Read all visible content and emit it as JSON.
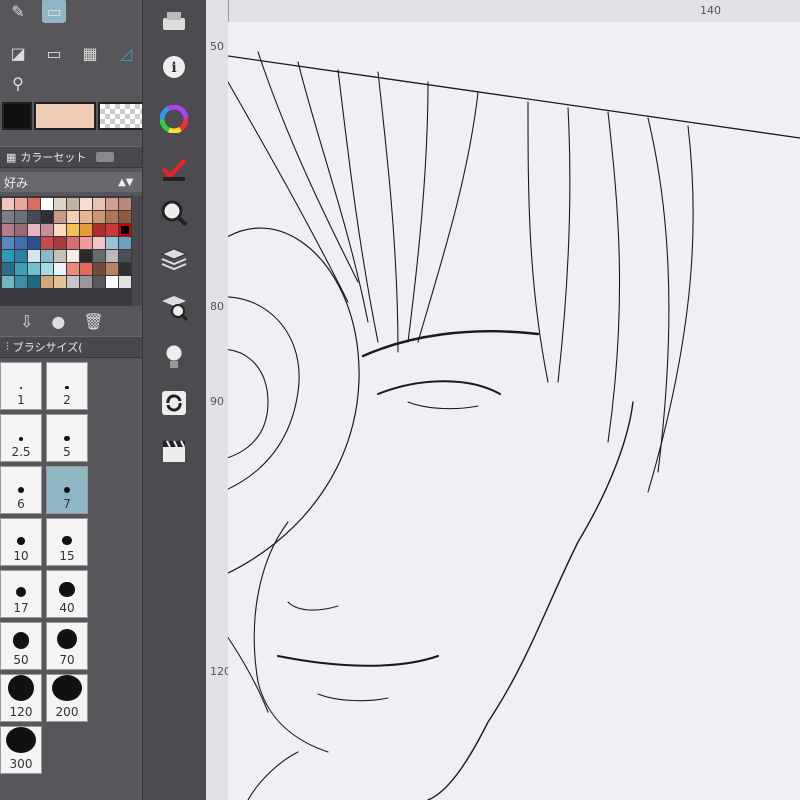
{
  "panels": {
    "color_set": {
      "title": "カラーセット",
      "preset": "好み"
    },
    "brush_size": {
      "title": "ブラシサイズ("
    }
  },
  "brush_sizes": [
    "1",
    "2",
    "2.5",
    "5",
    "6",
    "7",
    "10",
    "15",
    "17",
    "40",
    "50",
    "70",
    "120",
    "200",
    "300"
  ],
  "selected_brush_size": "7",
  "ruler": {
    "h_labels": [
      "140"
    ],
    "v_labels": [
      "50",
      "80",
      "90",
      "120"
    ]
  },
  "colors": {
    "accent_selected": "#8fb7c3",
    "main_color": "#111111",
    "sub_color": "#f0cdb4",
    "panel_bg": "#58565a",
    "canvas_bg": "#f1eff3"
  },
  "palette": [
    "#f2c6be",
    "#e8a59a",
    "#d66e62",
    "#ffffff",
    "#ddd3c6",
    "#c3b39e",
    "#f4ded0",
    "#e7c2b3",
    "#d39f91",
    "#b88a7e",
    "#7a7d86",
    "#6d6f78",
    "#454a55",
    "#2e2f36",
    "#c89b82",
    "#f1d1b8",
    "#e7b695",
    "#d19472",
    "#b27458",
    "#8f593f",
    "#b57b86",
    "#9b6876",
    "#e8b6c1",
    "#c28f9a",
    "#f7d9c4",
    "#f2c14f",
    "#e59a3a",
    "#b1282d",
    "#c73a39",
    "#000000",
    "#5b86c8",
    "#3f6fb1",
    "#2b4f8e",
    "#c84a4a",
    "#a83c3c",
    "#d46f6f",
    "#ee9d9d",
    "#f3c5c5",
    "#9ac3d8",
    "#6fa0bc",
    "#2b9bb3",
    "#2f7fa3",
    "#d8e5ea",
    "#89b8c9",
    "#c8c0b6",
    "#f5ece3",
    "#2a2a2a",
    "#6a6a6a",
    "#b9b9b9",
    "#4a4f56",
    "#2c6e89",
    "#3aa1b7",
    "#6fc2d0",
    "#a5dbe2",
    "#e8f4f6",
    "#ea8a7a",
    "#df6a5a",
    "#6f4b3a",
    "#b68462",
    "#2f2f2f",
    "#70b8c4",
    "#3d8fa6",
    "#1f6a80",
    "#d3a77c",
    "#e6c299",
    "#c7c4c8",
    "#9b989c",
    "#5b585c",
    "#ffffff",
    "#e0e0e0"
  ],
  "icons": {
    "tools": [
      "pen-icon",
      "fill-icon",
      "rect-icon",
      "frame-icon",
      "ruler-icon",
      "text-icon",
      "eyedropper-icon"
    ],
    "command_bar": [
      "layer-export-icon",
      "info-icon",
      "color-wheel-icon",
      "checkmark-icon",
      "search-icon",
      "layers-icon",
      "layer-search-icon",
      "lightbulb-icon",
      "sync-icon",
      "clapper-icon"
    ]
  }
}
